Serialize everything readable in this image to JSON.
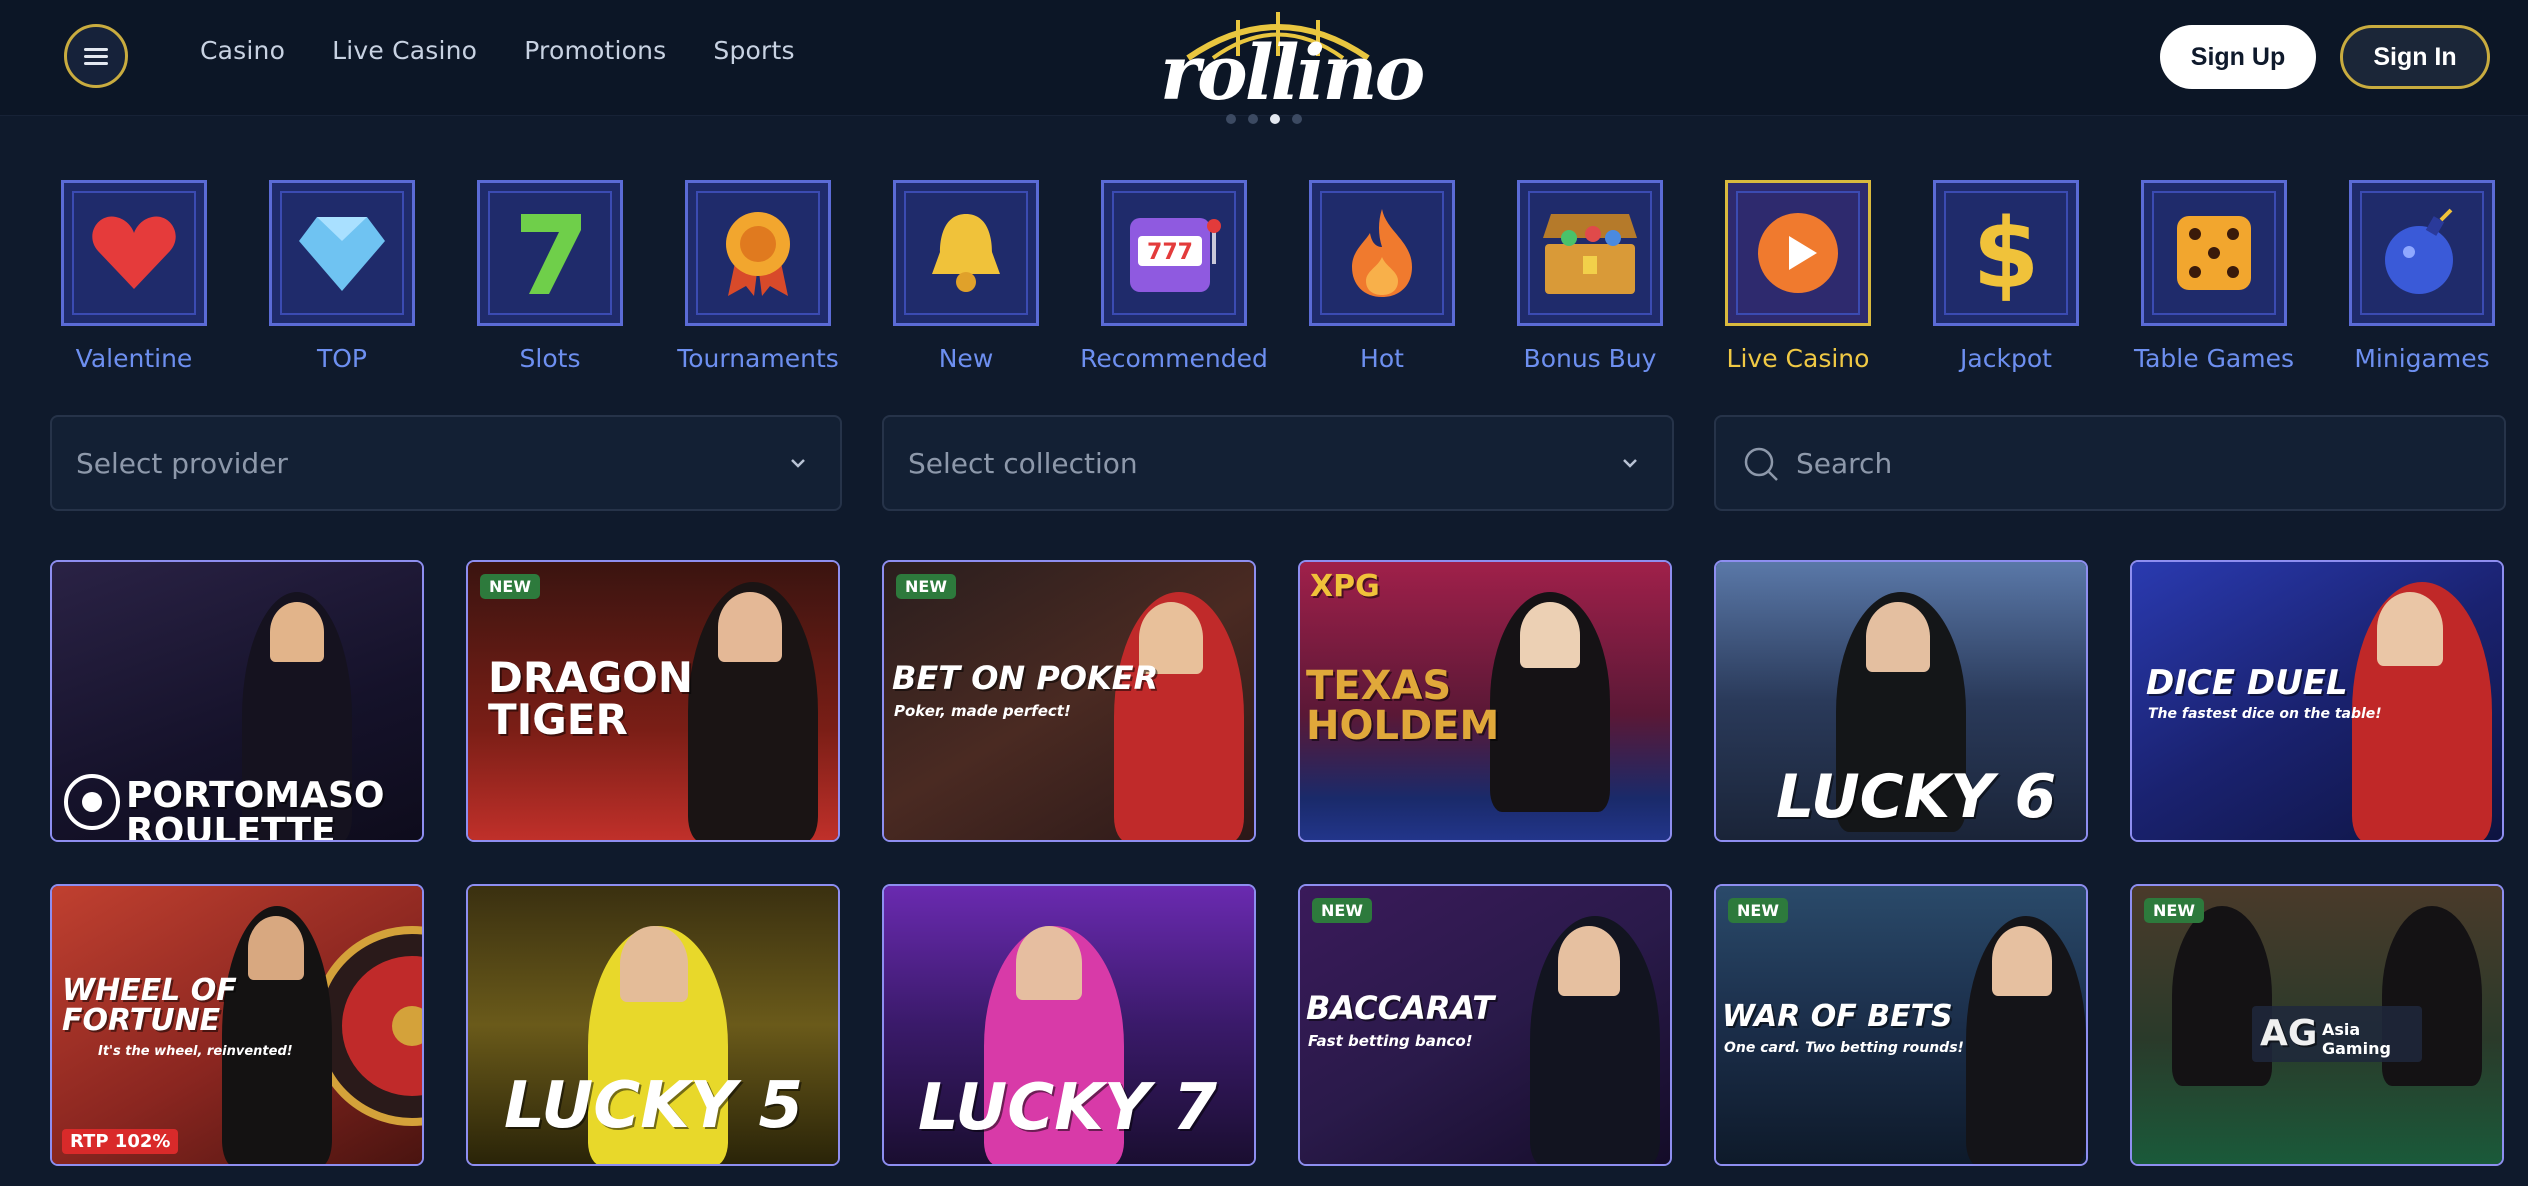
{
  "header": {
    "nav": [
      "Casino",
      "Live Casino",
      "Promotions",
      "Sports"
    ],
    "logo_text": "rollino",
    "sign_up": "Sign Up",
    "sign_in": "Sign In"
  },
  "categories": [
    {
      "label": "Valentine",
      "icon": "heart-icon"
    },
    {
      "label": "TOP",
      "icon": "diamond-icon"
    },
    {
      "label": "Slots",
      "icon": "seven-icon"
    },
    {
      "label": "Tournaments",
      "icon": "medal-icon"
    },
    {
      "label": "New",
      "icon": "bell-icon"
    },
    {
      "label": "Recommended",
      "icon": "slot-machine-icon"
    },
    {
      "label": "Hot",
      "icon": "flame-icon"
    },
    {
      "label": "Bonus Buy",
      "icon": "treasure-chest-icon"
    },
    {
      "label": "Live Casino",
      "icon": "play-icon"
    },
    {
      "label": "Jackpot",
      "icon": "dollar-icon"
    },
    {
      "label": "Table Games",
      "icon": "dice-icon"
    },
    {
      "label": "Minigames",
      "icon": "bomb-icon"
    }
  ],
  "active_category": "Live Casino",
  "filters": {
    "provider_placeholder": "Select provider",
    "collection_placeholder": "Select collection",
    "search_placeholder": "Search"
  },
  "games": [
    {
      "title": "PORTOMASO ROULETTE",
      "badge": "",
      "sub": "",
      "theme": "#1c1a33"
    },
    {
      "title": "DRAGON TIGER",
      "badge": "NEW",
      "sub": "",
      "theme": "#5a1d17"
    },
    {
      "title": "BET ON POKER",
      "badge": "NEW",
      "sub": "Poker, made perfect!",
      "theme": "#4a2a22"
    },
    {
      "title": "TEXAS HOLDEM",
      "badge": "",
      "sub": "",
      "brand": "XPG",
      "theme": "#6b1f43"
    },
    {
      "title": "LUCKY 6",
      "badge": "",
      "sub": "",
      "theme": "#3a4a6b"
    },
    {
      "title": "DICE DUEL",
      "badge": "",
      "sub": "The fastest dice on the table!",
      "theme": "#1d2570"
    },
    {
      "title": "WHEEL OF FORTUNE",
      "badge": "RTP 102%",
      "sub": "It's the wheel, reinvented!",
      "theme": "#8a2620"
    },
    {
      "title": "LUCKY 5",
      "badge": "",
      "sub": "",
      "theme": "#5a4c15"
    },
    {
      "title": "LUCKY 7",
      "badge": "",
      "sub": "",
      "theme": "#4a1d6b"
    },
    {
      "title": "BACCARAT",
      "badge": "NEW",
      "sub": "Fast betting banco!",
      "theme": "#2a1a4a"
    },
    {
      "title": "WAR OF BETS",
      "badge": "NEW",
      "sub": "One card. Two betting rounds!",
      "theme": "#1b2e4a"
    },
    {
      "title": "Asia Gaming",
      "badge": "NEW",
      "sub": "",
      "brand": "AG",
      "theme": "#2a3a2a"
    }
  ]
}
